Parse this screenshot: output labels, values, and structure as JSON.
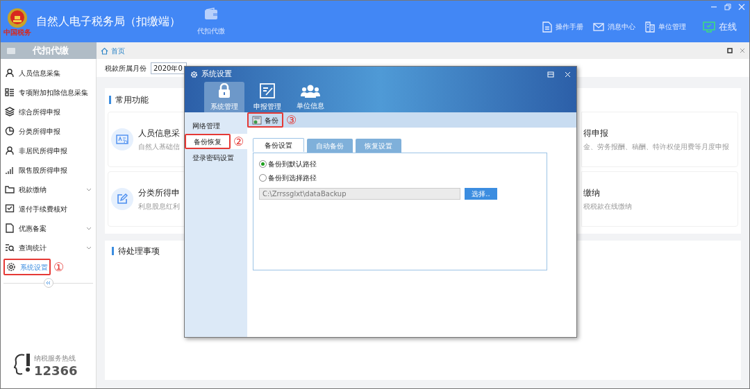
{
  "header": {
    "logo_text": "中国税务",
    "title": "自然人电子税务局（扣缴端）",
    "nav": [
      {
        "label": "代扣代缴",
        "selected": false
      }
    ],
    "links": [
      {
        "label": "操作手册",
        "kind": "manual"
      },
      {
        "label": "消息中心",
        "kind": "message"
      },
      {
        "label": "单位管理",
        "kind": "unit"
      },
      {
        "label": "在线",
        "kind": "online"
      }
    ]
  },
  "sidebar": {
    "title": "代扣代缴",
    "items": [
      {
        "label": "人员信息采集",
        "kind": "person",
        "expandable": false,
        "selected": false
      },
      {
        "label": "专项附加扣除信息采集",
        "kind": "list",
        "expandable": false,
        "selected": false
      },
      {
        "label": "综合所得申报",
        "kind": "layers",
        "expandable": false,
        "selected": false
      },
      {
        "label": "分类所得申报",
        "kind": "pie",
        "expandable": false,
        "selected": false
      },
      {
        "label": "非居民所得申报",
        "kind": "person",
        "expandable": false,
        "selected": false
      },
      {
        "label": "限售股所得申报",
        "kind": "bars",
        "expandable": false,
        "selected": false
      },
      {
        "label": "税款缴纳",
        "kind": "folder",
        "expandable": true,
        "selected": false
      },
      {
        "label": "退付手续费核对",
        "kind": "check",
        "expandable": false,
        "selected": false
      },
      {
        "label": "优惠备案",
        "kind": "doc",
        "expandable": true,
        "selected": false
      },
      {
        "label": "查询统计",
        "kind": "search",
        "expandable": true,
        "selected": false
      },
      {
        "label": "系统设置",
        "kind": "gear",
        "expandable": false,
        "selected": true,
        "annotation": "①"
      }
    ],
    "hotline_label": "纳税服务热线",
    "hotline": "12366"
  },
  "tab": {
    "label": "首页"
  },
  "main": {
    "month_label": "税款所属月份",
    "month_value": "2020年0",
    "common_title": "常用功能",
    "functions": [
      {
        "title": "人员信息采",
        "desc": "自然人基础信",
        "right_title": "得申报",
        "right_desc": "金、劳务报酬、稿酬、特许权使用费等月度申报",
        "kind": "card"
      },
      {
        "title": "分类所得申",
        "desc": "利息股息红利",
        "right_title": "缴纳",
        "right_desc": "税税款在线缴纳",
        "kind": "edit"
      }
    ],
    "pending_title": "待处理事项"
  },
  "dialog": {
    "title": "系统设置",
    "toolbar": [
      {
        "label": "系统管理",
        "kind": "lock",
        "selected": true
      },
      {
        "label": "申报管理",
        "kind": "form",
        "selected": false
      },
      {
        "label": "单位信息",
        "kind": "group",
        "selected": false
      }
    ],
    "nav": [
      {
        "label": "网络管理",
        "selected": false
      },
      {
        "label": "备份恢复",
        "selected": true,
        "annotation": "②"
      },
      {
        "label": "登录密码设置",
        "selected": false
      }
    ],
    "action": {
      "label": "备份",
      "annotation": "③"
    },
    "tabs": [
      {
        "label": "备份设置",
        "selected": true
      },
      {
        "label": "自动备份",
        "selected": false
      },
      {
        "label": "恢复设置",
        "selected": false
      }
    ],
    "options": [
      {
        "label": "备份到默认路径",
        "selected": true
      },
      {
        "label": "备份到选择路径",
        "selected": false
      }
    ],
    "path": {
      "value": "C:\\Zrrssglxt\\dataBackup",
      "disabled": true
    },
    "choose_button": "选择.."
  }
}
